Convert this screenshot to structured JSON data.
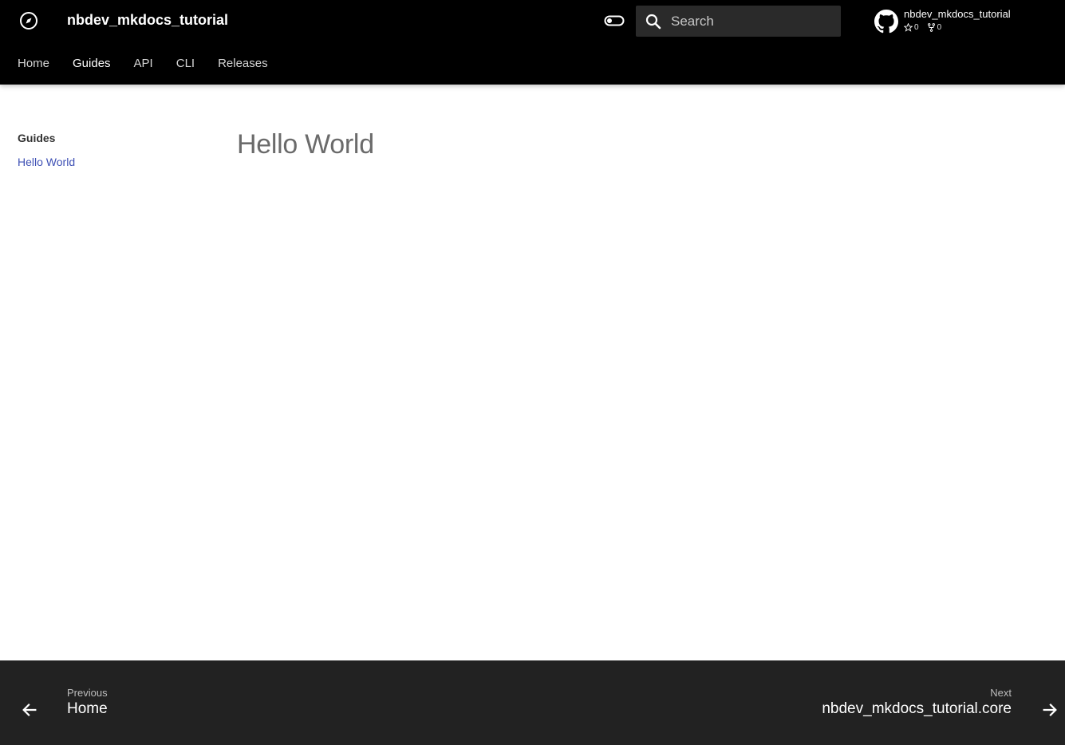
{
  "header": {
    "site_title": "nbdev_mkdocs_tutorial",
    "logo_icon": "compass-icon",
    "palette_toggle_icon": "toggle-switch-icon",
    "search": {
      "placeholder": "Search",
      "value": ""
    },
    "repo": {
      "name": "nbdev_mkdocs_tutorial",
      "stars": "0",
      "forks": "0"
    }
  },
  "tabs": [
    {
      "label": "Home"
    },
    {
      "label": "Guides",
      "active": true
    },
    {
      "label": "API"
    },
    {
      "label": "CLI"
    },
    {
      "label": "Releases"
    }
  ],
  "sidebar": {
    "title": "Guides",
    "items": [
      {
        "label": "Hello World"
      }
    ]
  },
  "main": {
    "title": "Hello World"
  },
  "footer": {
    "prev": {
      "direction": "Previous",
      "title": "Home"
    },
    "next": {
      "direction": "Next",
      "title": "nbdev_mkdocs_tutorial.core"
    }
  },
  "colors": {
    "header_bg": "#000000",
    "footer_bg": "#222222",
    "link": "#3f51b5"
  }
}
